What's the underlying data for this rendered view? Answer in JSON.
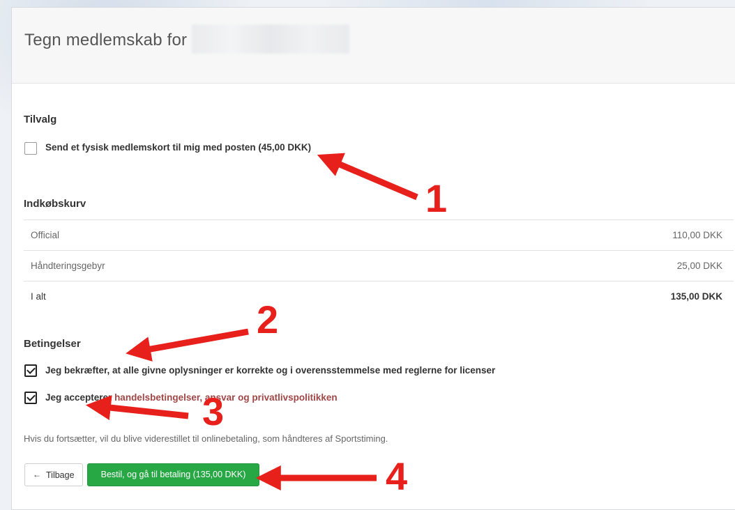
{
  "header": {
    "title": "Tegn medlemskab for"
  },
  "addons": {
    "heading": "Tilvalg",
    "option_label": "Send et fysisk medlemskort til mig med posten (45,00 DKK)",
    "option_checked": false
  },
  "cart": {
    "heading": "Indkøbskurv",
    "rows": [
      {
        "label": "Official",
        "value": "110,00 DKK"
      },
      {
        "label": "Håndteringsgebyr",
        "value": "25,00 DKK"
      },
      {
        "label": "I alt",
        "value": "135,00 DKK"
      }
    ]
  },
  "terms": {
    "heading": "Betingelser",
    "confirm_label": "Jeg bekræfter, at alle givne oplysninger er korrekte og i overensstemmelse med reglerne for licenser",
    "confirm_checked": true,
    "accept_prefix": "Jeg accepterer ",
    "accept_link": "handelsbetingelser, ansvar og privatlivspolitikken",
    "accept_checked": true
  },
  "note": "Hvis du fortsætter, vil du blive viderestillet til onlinebetaling, som håndteres af Sportstiming.",
  "buttons": {
    "back_label": "Tilbage",
    "order_label": "Bestil, og gå til betaling (135,00 DKK)"
  },
  "annotations": {
    "color": "#e8201c",
    "labels": [
      "1",
      "2",
      "3",
      "4"
    ]
  },
  "icons": {
    "back": "arrow-left-icon",
    "checkmark": "checkmark-icon"
  }
}
